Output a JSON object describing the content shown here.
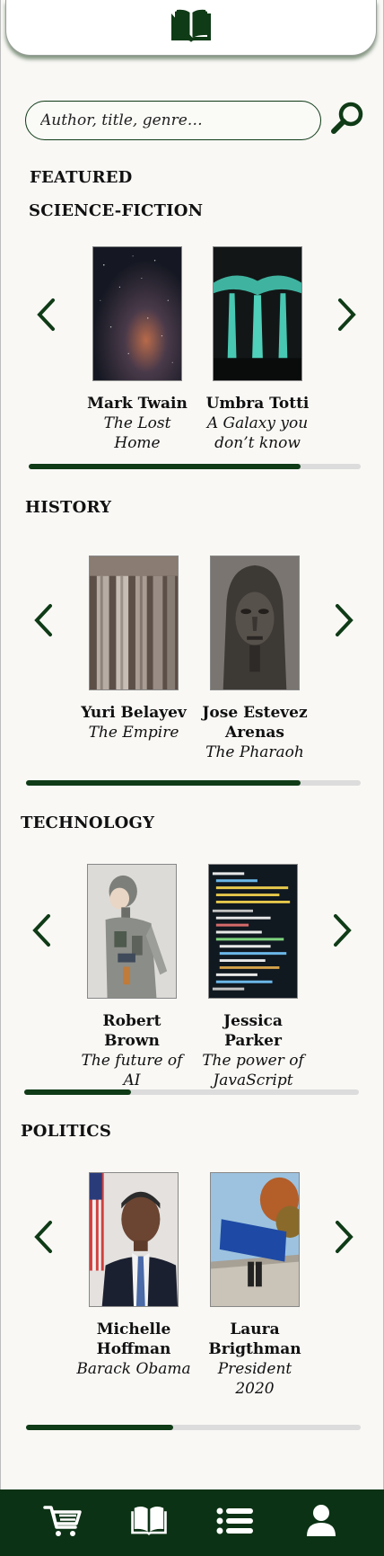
{
  "search": {
    "placeholder": "Author, title, genre…"
  },
  "featured_label": "FEATURED",
  "colors": {
    "accent": "#0f3b16",
    "nav_bg": "#0b3214",
    "track": "#dcdcdc",
    "background": "#f9f8f5"
  },
  "sections": [
    {
      "title": "SCIENCE-FICTION",
      "progress": 0.82,
      "books": [
        {
          "author": "Mark Twain",
          "title": "The Lost Home"
        },
        {
          "author": "Umbra Totti",
          "title": "A Galaxy you don’t know"
        }
      ]
    },
    {
      "title": "HISTORY",
      "progress": 0.82,
      "books": [
        {
          "author": "Yuri Belayev",
          "title": "The Empire"
        },
        {
          "author": "Jose Estevez Arenas",
          "title": "The Pharaoh"
        }
      ]
    },
    {
      "title": "TECHNOLOGY",
      "progress": 0.32,
      "books": [
        {
          "author": "Robert Brown",
          "title": "The future of AI"
        },
        {
          "author": "Jessica Parker",
          "title": "The power of JavaScript"
        }
      ]
    },
    {
      "title": "POLITICS",
      "progress": 0.44,
      "books": [
        {
          "author": "Michelle Hoffman",
          "title": "Barack Obama"
        },
        {
          "author": "Laura Brigthman",
          "title": "President 2020"
        }
      ]
    }
  ],
  "nav": [
    "cart-icon",
    "book-icon",
    "list-icon",
    "user-icon"
  ]
}
